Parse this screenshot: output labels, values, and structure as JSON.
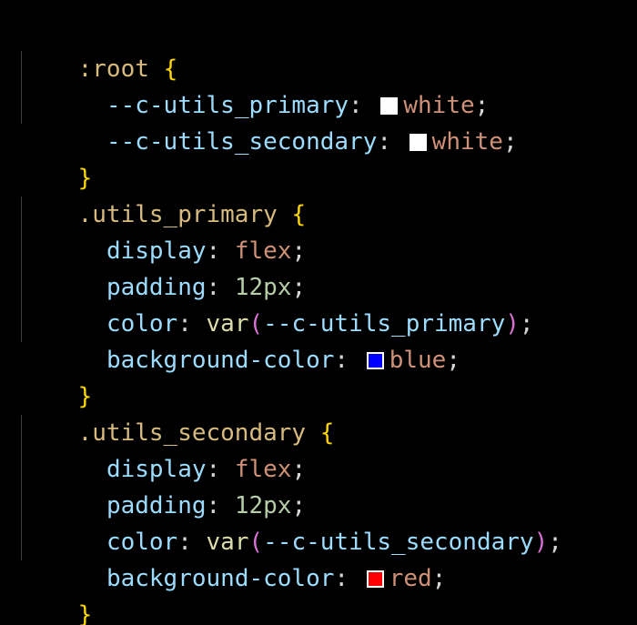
{
  "colors": {
    "background": "#000000",
    "selector": "#d7ba7d",
    "brace": "#ffd700",
    "property": "#9cdcfe",
    "value": "#ce9178",
    "number": "#b5cea8",
    "function": "#dcdcaa",
    "paren": "#da70d6",
    "punctuation": "#d4d4d4",
    "indent_guide": "#404040"
  },
  "code": {
    "root_selector": ":root",
    "open_brace": "{",
    "close_brace": "}",
    "colon": ":",
    "semicolon": ";",
    "open_paren": "(",
    "close_paren_semicolon_paren": ")",
    "root_vars": [
      {
        "name": "--c-utils_primary",
        "value": "white",
        "swatch": "#ffffff"
      },
      {
        "name": "--c-utils_secondary",
        "value": "white",
        "swatch": "#ffffff"
      }
    ],
    "rules": [
      {
        "selector": ".utils_primary",
        "display_prop": "display",
        "display_value": "flex",
        "padding_prop": "padding",
        "padding_value": "12px",
        "color_prop": "color",
        "color_func": "var",
        "color_var": "--c-utils_primary",
        "bg_prop": "background-color",
        "bg_value": "blue",
        "bg_swatch": "#0000ff"
      },
      {
        "selector": ".utils_secondary",
        "display_prop": "display",
        "display_value": "flex",
        "padding_prop": "padding",
        "padding_value": "12px",
        "color_prop": "color",
        "color_func": "var",
        "color_var": "--c-utils_secondary",
        "bg_prop": "background-color",
        "bg_value": "red",
        "bg_swatch": "#ff0000"
      }
    ]
  }
}
